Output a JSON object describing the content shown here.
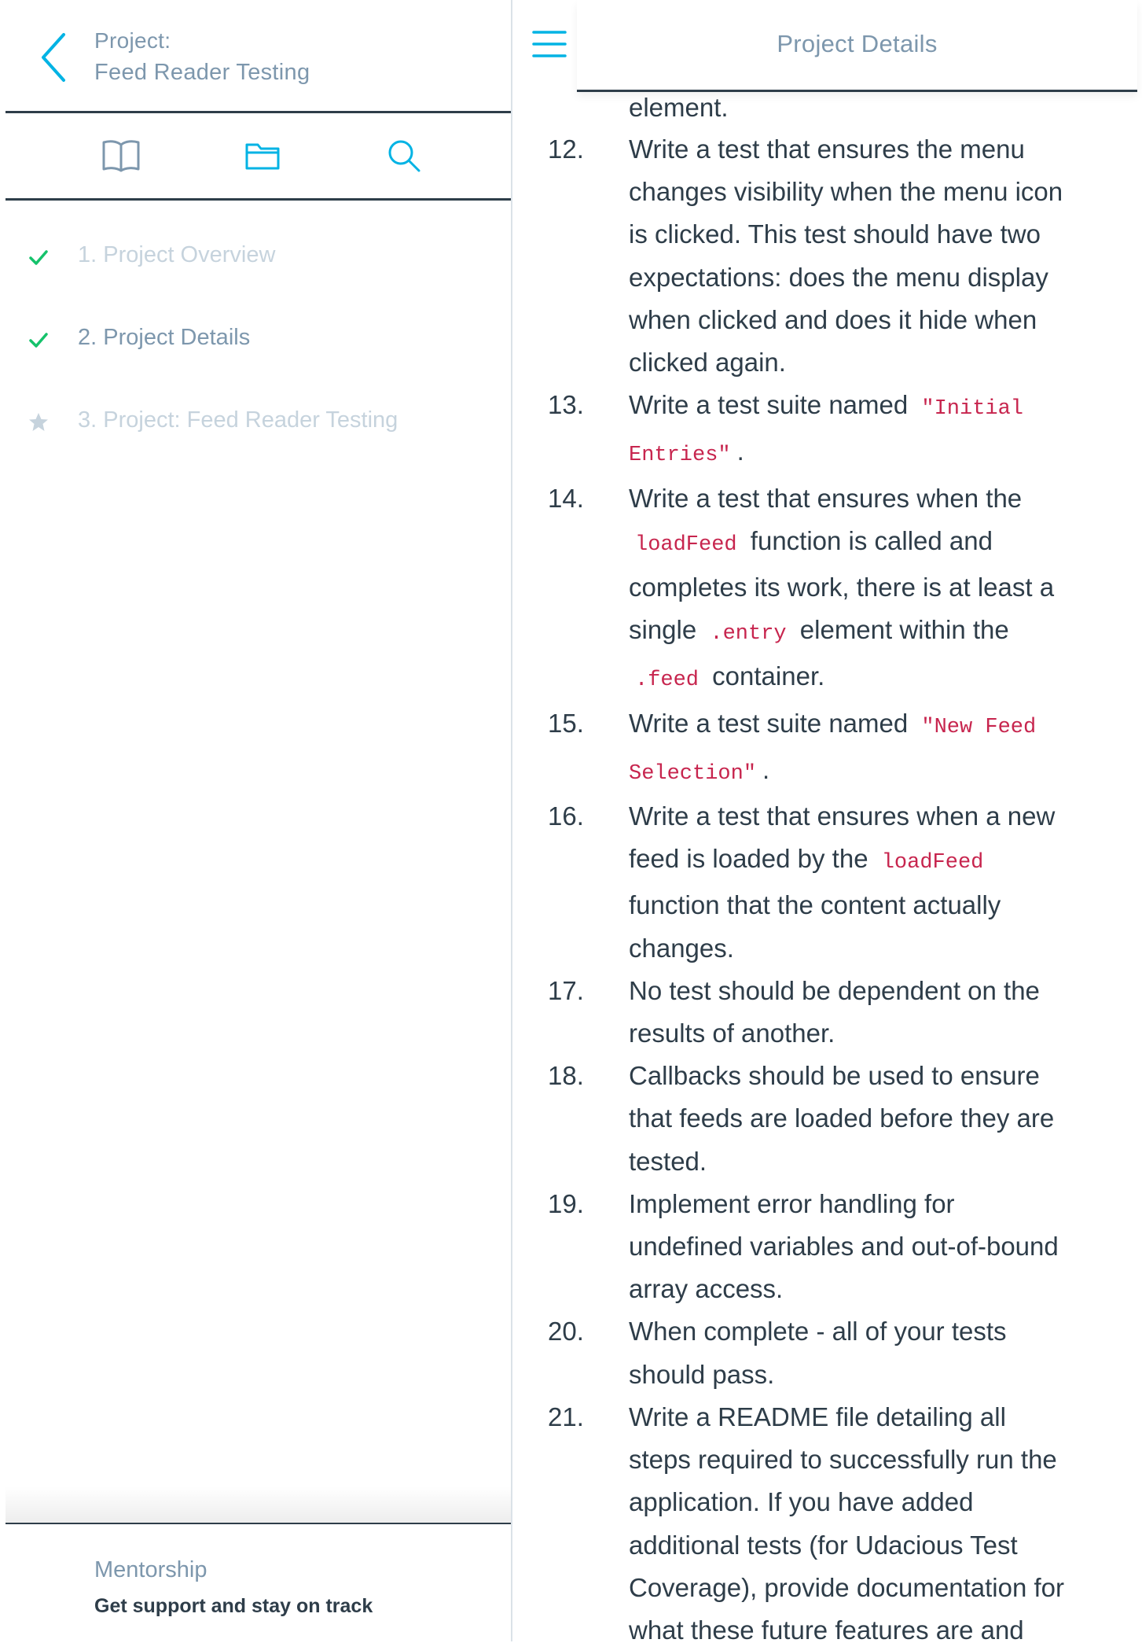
{
  "sidebar": {
    "header": {
      "project_label": "Project:",
      "project_name": "Feed Reader Testing"
    },
    "tabs": [
      {
        "name": "book-icon",
        "active": false
      },
      {
        "name": "folder-icon",
        "active": true
      },
      {
        "name": "search-icon",
        "active": false
      }
    ],
    "items": [
      {
        "label": "1. Project Overview",
        "status": "check",
        "muted": true
      },
      {
        "label": "2. Project Details",
        "status": "check",
        "muted": false
      },
      {
        "label": "3. Project: Feed Reader Testing",
        "status": "star",
        "muted": true
      }
    ],
    "footer": {
      "title": "Mentorship",
      "subtitle": "Get support and stay on track"
    }
  },
  "topbar": {
    "title": "Project Details",
    "menu_icon": "hamburger-menu-icon"
  },
  "content": {
    "fragment": "element.",
    "items": [
      {
        "num": "12.",
        "parts": [
          {
            "t": "Write a test that ensures the menu changes visibility when the menu icon is clicked. This test should have two expectations: does the menu display when clicked and does it hide when clicked again."
          }
        ]
      },
      {
        "num": "13.",
        "parts": [
          {
            "t": "Write a test suite named "
          },
          {
            "c": "\"Initial Entries\""
          },
          {
            "t": "."
          }
        ]
      },
      {
        "num": "14.",
        "parts": [
          {
            "t": "Write a test that ensures when the "
          },
          {
            "c": "loadFeed"
          },
          {
            "t": " function is called and completes its work, there is at least a single "
          },
          {
            "c": ".entry"
          },
          {
            "t": " element within the "
          },
          {
            "c": ".feed"
          },
          {
            "t": " container."
          }
        ]
      },
      {
        "num": "15.",
        "parts": [
          {
            "t": "Write a test suite named "
          },
          {
            "c": "\"New Feed Selection\""
          },
          {
            "t": "."
          }
        ]
      },
      {
        "num": "16.",
        "parts": [
          {
            "t": "Write a test that ensures when a new feed is loaded by the "
          },
          {
            "c": "loadFeed"
          },
          {
            "t": " function that the content actually changes."
          }
        ]
      },
      {
        "num": "17.",
        "parts": [
          {
            "t": "No test should be dependent on the results of another."
          }
        ]
      },
      {
        "num": "18.",
        "parts": [
          {
            "t": "Callbacks should be used to ensure that feeds are loaded before they are tested."
          }
        ]
      },
      {
        "num": "19.",
        "parts": [
          {
            "t": "Implement error handling for undefined variables and out-of-bound array access."
          }
        ]
      },
      {
        "num": "20.",
        "parts": [
          {
            "t": "When complete - all of your tests should pass."
          }
        ]
      },
      {
        "num": "21.",
        "parts": [
          {
            "t": "Write a README file detailing all steps required to successfully run the application. If you have added additional tests (for Udacious Test Coverage), provide documentation for what these future features are and"
          }
        ]
      }
    ]
  },
  "colors": {
    "accent": "#02b3e4",
    "check": "#15c26b",
    "text_dark": "#2e3d49",
    "text_muted": "#7d97ad",
    "text_faded": "#c6d3dd",
    "code": "#c7254e"
  }
}
